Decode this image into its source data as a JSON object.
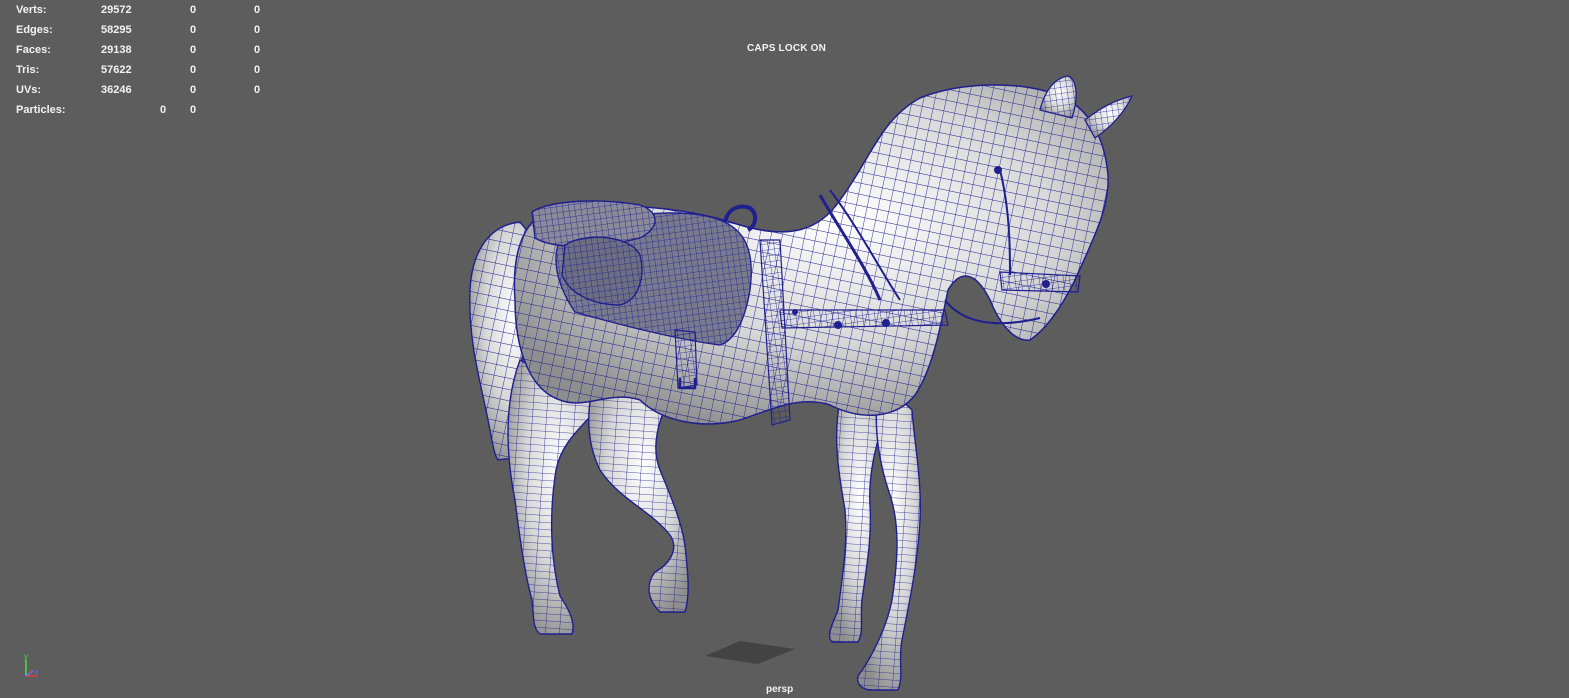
{
  "hud": {
    "rows": [
      {
        "label": "Verts:",
        "v1": "29572",
        "v2": "0",
        "v3": "0"
      },
      {
        "label": "Edges:",
        "v1": "58295",
        "v2": "0",
        "v3": "0"
      },
      {
        "label": "Faces:",
        "v1": "29138",
        "v2": "0",
        "v3": "0"
      },
      {
        "label": "Tris:",
        "v1": "57622",
        "v2": "0",
        "v3": "0"
      },
      {
        "label": "UVs:",
        "v1": "36246",
        "v2": "0",
        "v3": "0"
      },
      {
        "label": "Particles:",
        "v1": "0",
        "v2": "0"
      }
    ]
  },
  "viewport": {
    "caps_lock": "CAPS LOCK ON",
    "camera": "persp"
  },
  "axis": {
    "y_label": "y",
    "x_label": "x",
    "z_label": "z"
  },
  "colors": {
    "background": "#5d5d5d",
    "wireframe": "#1f1f8f",
    "text": "#f2f2f2"
  }
}
